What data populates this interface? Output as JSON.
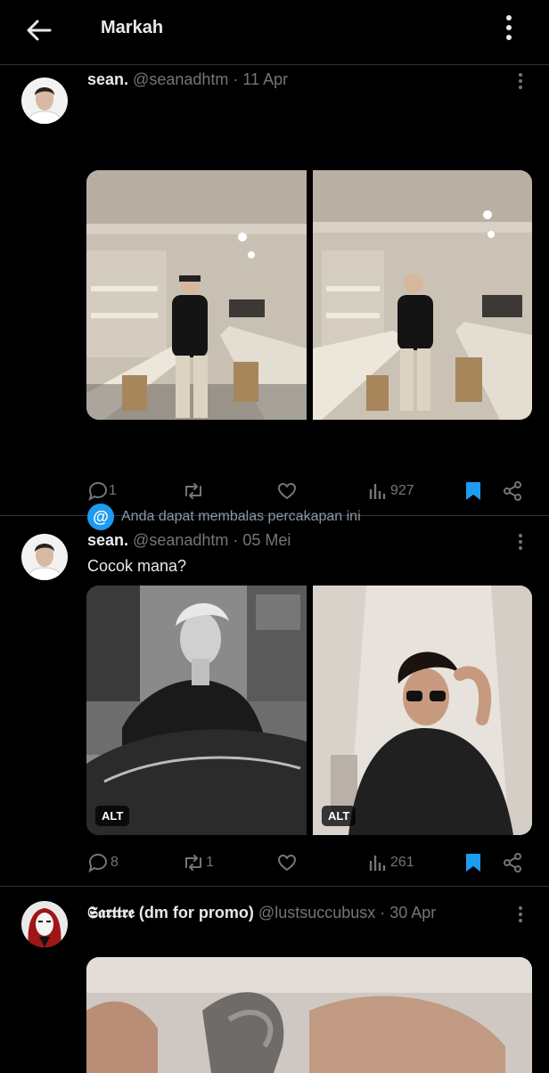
{
  "header": {
    "title": "Markah"
  },
  "tweets": [
    {
      "name": "sean.",
      "handle": "@seanadhtm",
      "date": "· 11 Apr",
      "text": "",
      "reply_note": "Anda dapat membalas percakapan ini",
      "reply_icon": "@",
      "stats": {
        "replies": "1",
        "retweets": "",
        "views": "927"
      }
    },
    {
      "name": "sean.",
      "handle": "@seanadhtm",
      "date": "· 05 Mei",
      "text": "Cocok mana?",
      "alt_label": "ALT",
      "stats": {
        "replies": "8",
        "retweets": "1",
        "views": "261"
      }
    },
    {
      "name": "𝕾𝖆𝖗𝖙𝖙𝖗𝖊 (dm for promo)",
      "handle": "@lustsuccubusx",
      "date": "· 30 Apr"
    }
  ],
  "colors": {
    "accent": "#1d9bf0",
    "muted": "#71767b",
    "background": "#000000"
  }
}
